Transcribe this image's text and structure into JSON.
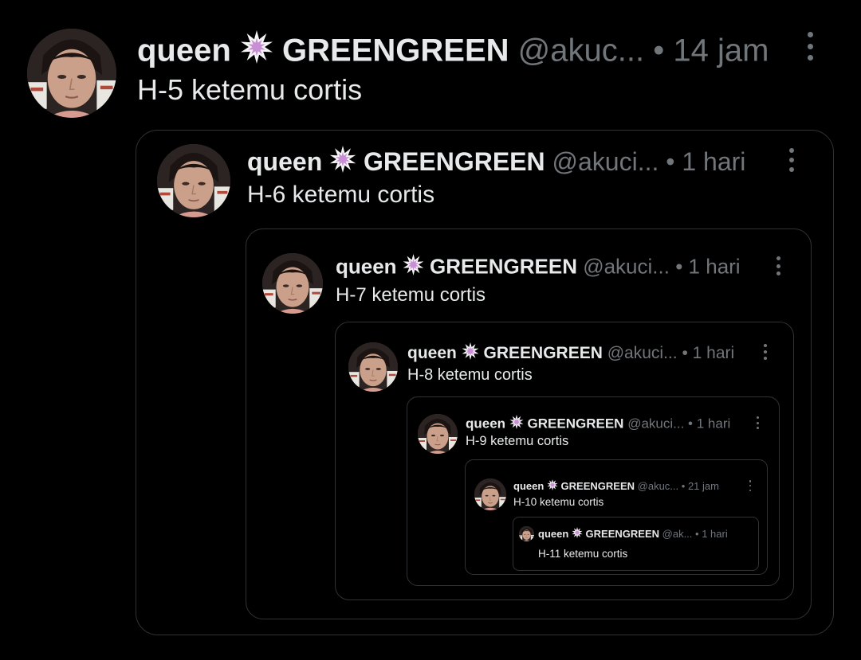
{
  "posts": [
    {
      "name": "queen",
      "display": "GREENGREEN",
      "handle": "@akuc...",
      "time": "14 jam",
      "text": "H-5 ketemu cortis"
    },
    {
      "name": "queen",
      "display": "GREENGREEN",
      "handle": "@akuci...",
      "time": "1 hari",
      "text": "H-6 ketemu cortis"
    },
    {
      "name": "queen",
      "display": "GREENGREEN",
      "handle": "@akuci...",
      "time": "1 hari",
      "text": "H-7 ketemu cortis"
    },
    {
      "name": "queen",
      "display": "GREENGREEN",
      "handle": "@akuci...",
      "time": "1 hari",
      "text": "H-8 ketemu cortis"
    },
    {
      "name": "queen",
      "display": "GREENGREEN",
      "handle": "@akuci...",
      "time": "1 hari",
      "text": "H-9 ketemu cortis"
    },
    {
      "name": "queen",
      "display": "GREENGREEN",
      "handle": "@akuc...",
      "time": "21 jam",
      "text": "H-10 ketemu cortis"
    },
    {
      "name": "queen",
      "display": "GREENGREEN",
      "handle": "@ak...",
      "time": "1 hari",
      "text": "H-11 ketemu cortis"
    }
  ],
  "separator": "•",
  "icons": {
    "badge": "explosion-badge-icon",
    "more": "more-options-icon"
  },
  "colors": {
    "background": "#000000",
    "text": "#e7e9ea",
    "muted": "#71767b",
    "border": "#2f3336"
  }
}
